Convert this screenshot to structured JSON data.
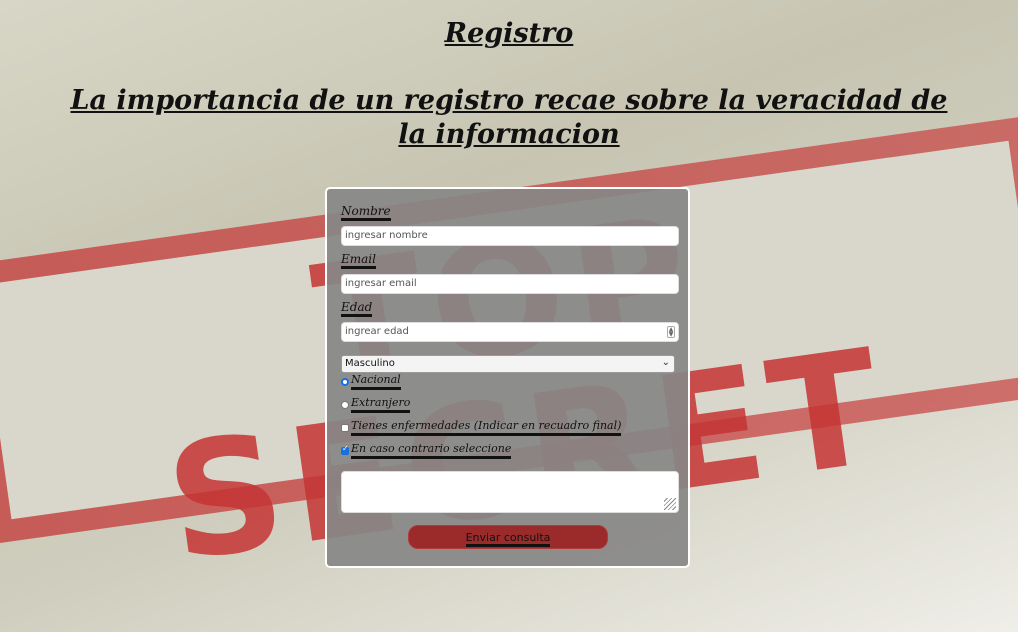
{
  "header": {
    "title": "Registro",
    "subtitle": "La importancia de un registro recae sobre la veracidad de la informacion"
  },
  "background": {
    "stamp_text": "TOP SECRET"
  },
  "form": {
    "name_label": "Nombre",
    "name_placeholder": "ingresar nombre",
    "email_label": "Email",
    "email_placeholder": "ingresar email",
    "age_label": "Edad",
    "age_placeholder": "ingrear edad",
    "gender_selected": "Masculino",
    "radio_national": "Nacional",
    "radio_foreign": "Extranjero",
    "checkbox_illness": "Tienes enfermedades (Indicar en recuadro final)",
    "checkbox_otherwise": "En caso contrario seleccione",
    "submit_label": "Enviar consulta"
  },
  "colors": {
    "button": "#9b2a2b",
    "stamp_red": "#c43434",
    "accent": "#1a6fe0"
  }
}
